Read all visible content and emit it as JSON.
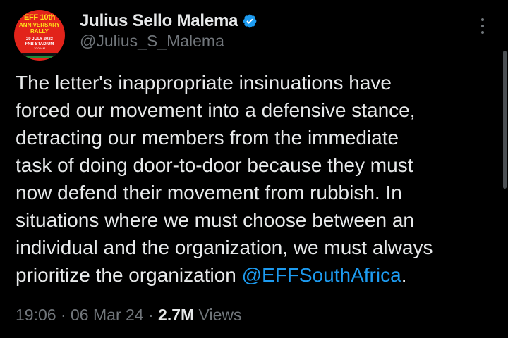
{
  "theme": {
    "background": "#000000",
    "text": "#e7e9ea",
    "muted": "#71767b",
    "link": "#1d9bf0",
    "verified_badge": "#1d9bf0"
  },
  "author": {
    "display_name": "Julius Sello Malema",
    "handle": "@Julius_S_Malema",
    "verified": true,
    "avatar": {
      "line1": "EFF 10th",
      "line2": "ANNIVERSARY",
      "line3": "RALLY",
      "line4": "29 JULY 2023",
      "line5": "FNB STADIUM",
      "line6": "10:00AM"
    }
  },
  "post": {
    "text_before_mention": "The letter's inappropriate insinuations have\nforced our movement into a defensive stance,\ndetracting our members from the immediate\ntask of doing door-to-door because they must\nnow defend their movement from rubbish. In\nsituations where we must choose between an\nindividual and the organization, we must always\nprioritize the organization ",
    "mention": "@EFFSouthAfrica",
    "text_after_mention": "."
  },
  "meta": {
    "time": "19:06",
    "separator": " · ",
    "date": "06 Mar 24",
    "views_count": "2.7M",
    "views_label": " Views"
  },
  "icons": {
    "verified": "verified-badge-icon",
    "more": "more-vertical-icon"
  }
}
